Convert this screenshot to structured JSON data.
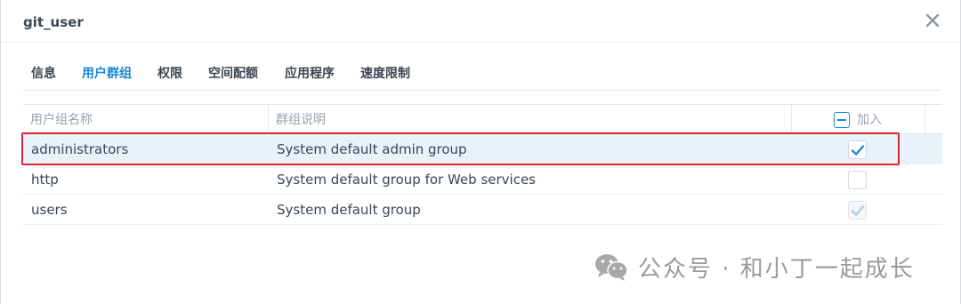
{
  "dialog": {
    "title": "git_user",
    "close_icon": "close-icon"
  },
  "tabs": [
    {
      "label": "信息",
      "active": false
    },
    {
      "label": "用户群组",
      "active": true
    },
    {
      "label": "权限",
      "active": false
    },
    {
      "label": "空间配额",
      "active": false
    },
    {
      "label": "应用程序",
      "active": false
    },
    {
      "label": "速度限制",
      "active": false
    }
  ],
  "table": {
    "headers": {
      "name": "用户组名称",
      "description": "群组说明",
      "join": "加入"
    },
    "rows": [
      {
        "name": "administrators",
        "description": "System default admin group",
        "checked": true,
        "disabled": false,
        "selected": true
      },
      {
        "name": "http",
        "description": "System default group for Web services",
        "checked": false,
        "disabled": false,
        "selected": false
      },
      {
        "name": "users",
        "description": "System default group",
        "checked": true,
        "disabled": true,
        "selected": false
      }
    ]
  },
  "watermark": {
    "text": "公众号 · 和小丁一起成长",
    "icon": "wechat-icon"
  },
  "colors": {
    "accent": "#1b87d6",
    "highlight_border": "#d9252f",
    "selected_row": "#e8f2fb"
  }
}
